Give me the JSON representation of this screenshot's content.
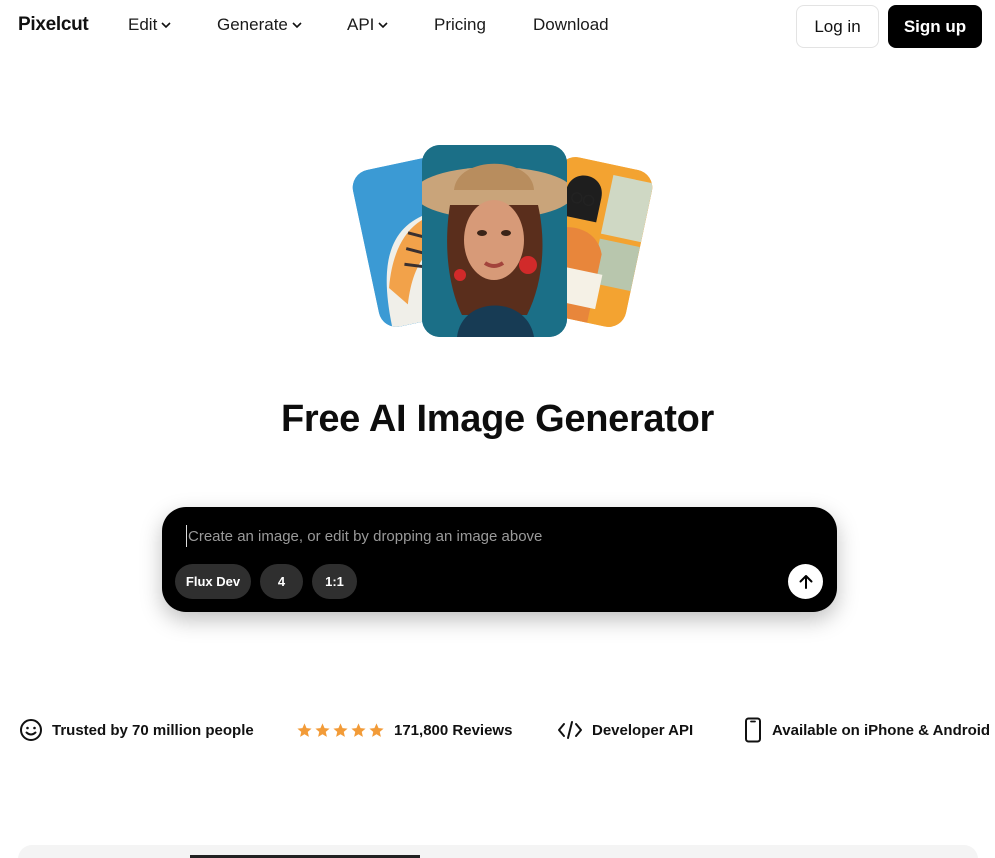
{
  "nav": {
    "brand": "Pixelcut",
    "items": [
      {
        "label": "Edit",
        "dropdown": true
      },
      {
        "label": "Generate",
        "dropdown": true
      },
      {
        "label": "API",
        "dropdown": true
      },
      {
        "label": "Pricing",
        "dropdown": false
      },
      {
        "label": "Download",
        "dropdown": false
      }
    ],
    "login_label": "Log in",
    "signup_label": "Sign up"
  },
  "hero": {
    "title": "Free AI Image Generator"
  },
  "prompt": {
    "placeholder": "Create an image, or edit by dropping an image above",
    "value": "",
    "chips": [
      {
        "label": "Flux Dev"
      },
      {
        "label": "4"
      },
      {
        "label": "1:1"
      }
    ],
    "send_icon": "arrow-up-icon"
  },
  "trust": {
    "people": "Trusted by 70 million people",
    "reviews": "171,800 Reviews",
    "rating_stars": 5,
    "api": "Developer API",
    "mobile": "Available on iPhone & Android"
  },
  "colors": {
    "primary": "#000000",
    "star": "#f29b38",
    "chip": "#2f2f2f"
  }
}
